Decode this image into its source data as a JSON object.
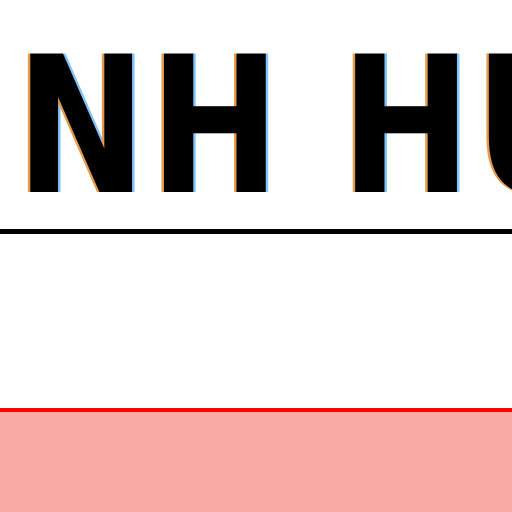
{
  "heading": {
    "text": "NH HU"
  },
  "colors": {
    "text": "#000000",
    "underline": "#000000",
    "alert_border": "#ff0000",
    "alert_fill": "#f9aaa2",
    "fringe_left": "#e69a4a",
    "fringe_right": "#7fc4ff"
  }
}
